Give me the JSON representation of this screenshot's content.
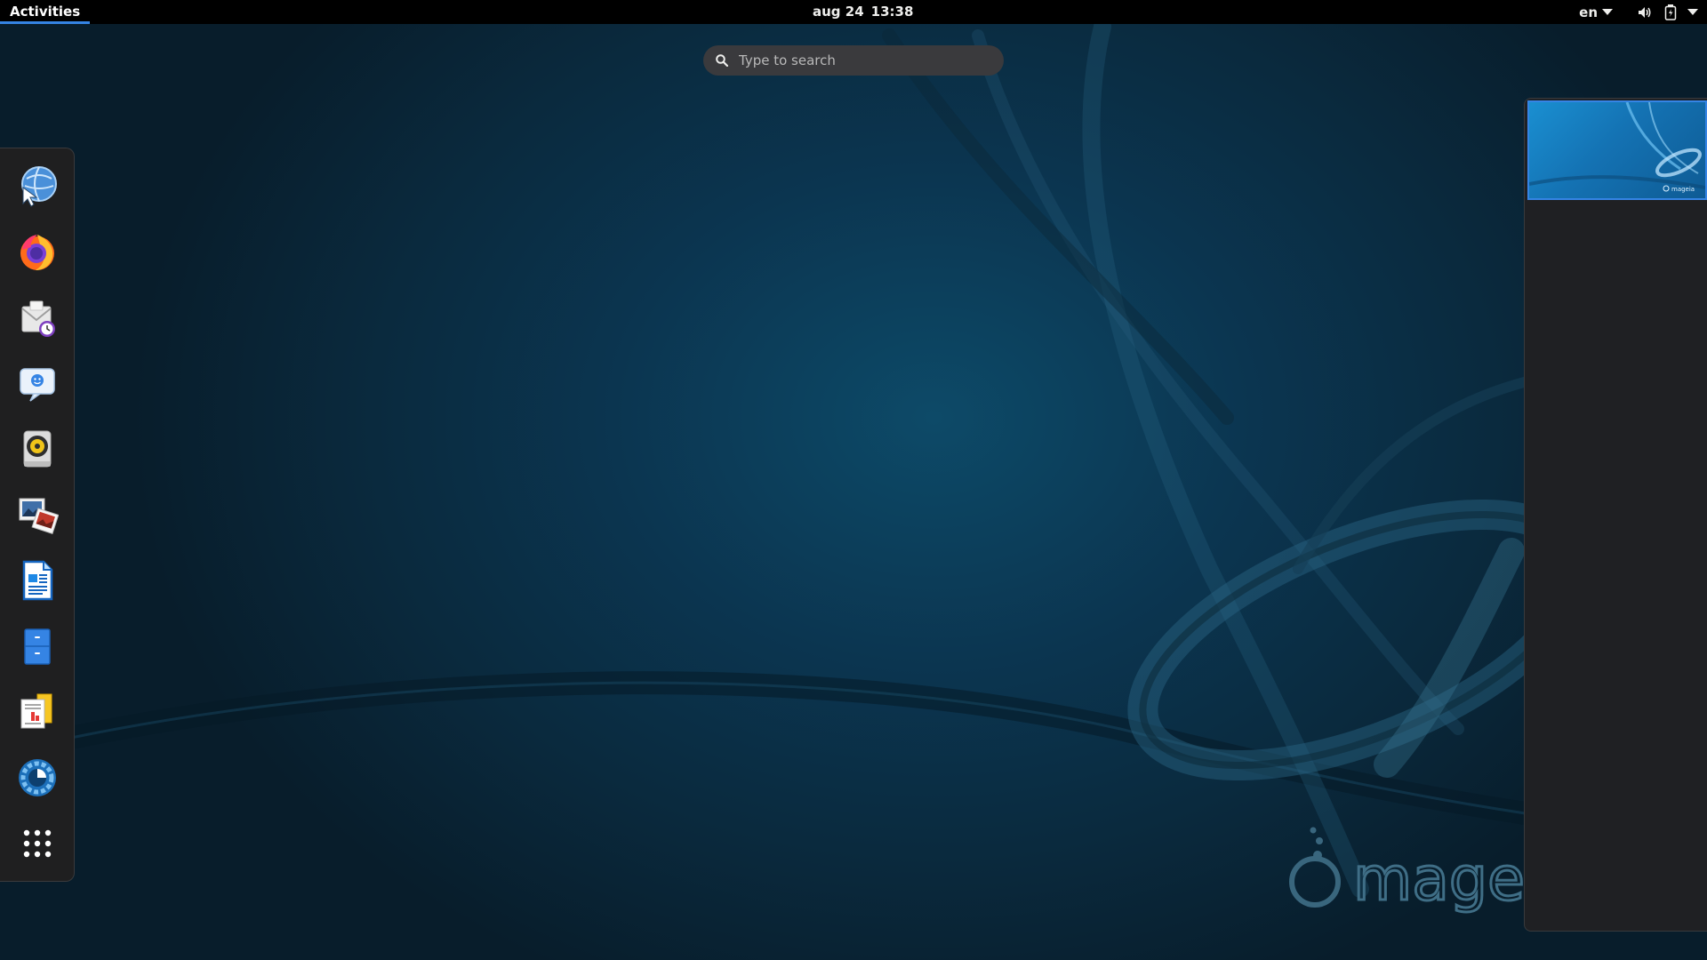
{
  "topbar": {
    "activities_label": "Activities",
    "date": "aug 24",
    "time": "13:38",
    "language": "en",
    "icons": [
      "volume-icon",
      "battery-icon",
      "system-menu-arrow-icon"
    ]
  },
  "search": {
    "placeholder": "Type to search",
    "value": ""
  },
  "dash": {
    "items": [
      {
        "name": "web-browser-icon"
      },
      {
        "name": "firefox-icon"
      },
      {
        "name": "evolution-mail-icon"
      },
      {
        "name": "empathy-chat-icon"
      },
      {
        "name": "rhythmbox-icon"
      },
      {
        "name": "shotwell-photos-icon"
      },
      {
        "name": "libreoffice-writer-icon"
      },
      {
        "name": "files-icon"
      },
      {
        "name": "document-viewer-icon"
      },
      {
        "name": "settings-icon"
      },
      {
        "name": "show-applications-icon"
      }
    ]
  },
  "wallpaper": {
    "brand": "mageia"
  },
  "workspace": {
    "thumbnail_brand": "mageia"
  },
  "colors": {
    "accent": "#3584e4",
    "topbar": "#000000",
    "background": "#0b3550"
  }
}
